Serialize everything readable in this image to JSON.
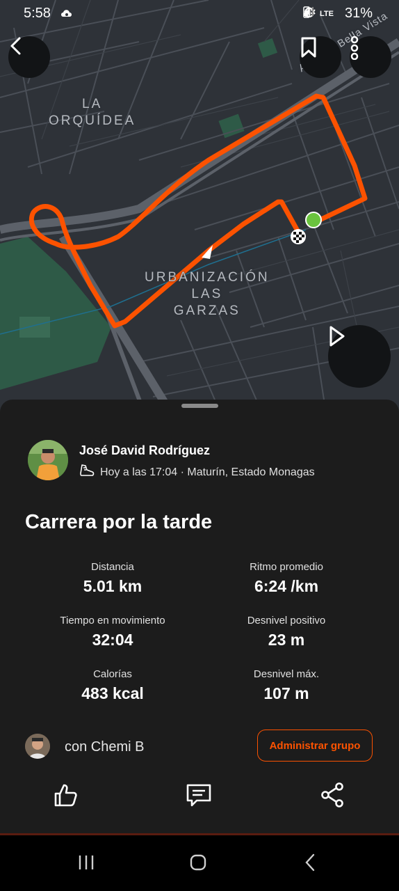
{
  "status_bar": {
    "time": "5:58",
    "network": "LTE",
    "battery": "31%"
  },
  "map": {
    "labels": {
      "neighborhood_1": [
        "LA",
        "ORQUÍDEA"
      ],
      "neighborhood_2": [
        "URBANIZACIÓN",
        "LAS",
        "GARZAS"
      ],
      "street": "Avenida Bella Vista"
    },
    "route_color": "#fc5200",
    "start_color": "#6ac33e"
  },
  "activity": {
    "athlete_name": "José David Rodríguez",
    "meta": "Hoy a las 17:04 · Maturín, Estado Monagas",
    "title": "Carrera por la tarde",
    "stats": [
      {
        "label": "Distancia",
        "value": "5.01 km"
      },
      {
        "label": "Ritmo promedio",
        "value": "6:24 /km"
      },
      {
        "label": "Tiempo en movimiento",
        "value": "32:04"
      },
      {
        "label": "Desnivel positivo",
        "value": "23 m"
      },
      {
        "label": "Calorías",
        "value": "483 kcal"
      },
      {
        "label": "Desnivel máx.",
        "value": "107 m"
      }
    ],
    "with_text": "con Chemi B",
    "admin_button": "Administrar grupo"
  },
  "colors": {
    "accent": "#fc5200",
    "sheet_bg": "#1c1c1c",
    "map_bg": "#2e3238"
  }
}
